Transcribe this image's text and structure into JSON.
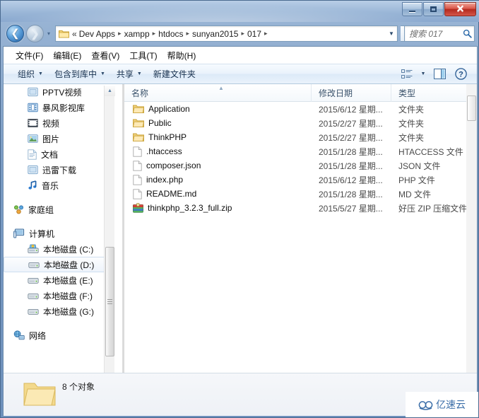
{
  "window": {
    "caption_buttons": [
      {
        "name": "minimize",
        "label": "—"
      },
      {
        "name": "maximize",
        "label": "□"
      },
      {
        "name": "close",
        "label": "✕"
      }
    ]
  },
  "address_bar": {
    "back_label": "←",
    "forward_label": "→",
    "recent_label": "▼",
    "folder_icon": "folder-icon",
    "overflow": "«",
    "crumbs": [
      {
        "label": "Dev Apps"
      },
      {
        "label": "xampp"
      },
      {
        "label": "htdocs"
      },
      {
        "label": "sunyan2015"
      },
      {
        "label": "017"
      }
    ],
    "separator": "▸",
    "dropdown_label": "▼",
    "refresh_label": "↻"
  },
  "search": {
    "placeholder": "搜索 017",
    "icon": "search-icon"
  },
  "menubar": {
    "items": [
      {
        "label": "文件(F)",
        "name": "menu-file"
      },
      {
        "label": "编辑(E)",
        "name": "menu-edit"
      },
      {
        "label": "查看(V)",
        "name": "menu-view"
      },
      {
        "label": "工具(T)",
        "name": "menu-tools"
      },
      {
        "label": "帮助(H)",
        "name": "menu-help"
      }
    ]
  },
  "toolbar": {
    "items": [
      {
        "label": "组织",
        "caret": "▼",
        "name": "toolbar-organize"
      },
      {
        "label": "包含到库中",
        "caret": "▼",
        "name": "toolbar-include-in-library"
      },
      {
        "label": "共享",
        "caret": "▼",
        "name": "toolbar-share"
      },
      {
        "label": "新建文件夹",
        "caret": "",
        "name": "toolbar-new-folder"
      }
    ],
    "view_caret": "▼",
    "icons": {
      "views": "views-list-icon",
      "preview_pane": "preview-pane-icon",
      "help": "help-icon",
      "help_glyph": "?"
    }
  },
  "nav_pane": {
    "items": [
      {
        "label": "PPTV视频",
        "icon": "pptv-video-icon",
        "indent": "indent2",
        "selected": false
      },
      {
        "label": "暴风影视库",
        "icon": "storm-video-library-icon",
        "indent": "indent2",
        "selected": false
      },
      {
        "label": "视频",
        "icon": "videos-icon",
        "indent": "indent2",
        "selected": false
      },
      {
        "label": "图片",
        "icon": "pictures-icon",
        "indent": "indent2",
        "selected": false
      },
      {
        "label": "文档",
        "icon": "documents-icon",
        "indent": "indent2",
        "selected": false
      },
      {
        "label": "迅雷下载",
        "icon": "thunder-downloads-icon",
        "indent": "indent2",
        "selected": false
      },
      {
        "label": "音乐",
        "icon": "music-icon",
        "indent": "indent2",
        "selected": false
      },
      {
        "spacer": true
      },
      {
        "label": "家庭组",
        "icon": "homegroup-icon",
        "indent": "group",
        "selected": false
      },
      {
        "spacer": true
      },
      {
        "label": "计算机",
        "icon": "computer-icon",
        "indent": "group",
        "selected": false
      },
      {
        "label": "本地磁盘 (C:)",
        "icon": "system-drive-icon",
        "indent": "indent2",
        "selected": false
      },
      {
        "label": "本地磁盘 (D:)",
        "icon": "drive-icon",
        "indent": "indent2",
        "selected": true
      },
      {
        "label": "本地磁盘 (E:)",
        "icon": "drive-icon",
        "indent": "indent2",
        "selected": false
      },
      {
        "label": "本地磁盘 (F:)",
        "icon": "drive-icon",
        "indent": "indent2",
        "selected": false
      },
      {
        "label": "本地磁盘 (G:)",
        "icon": "drive-icon",
        "indent": "indent2",
        "selected": false
      },
      {
        "spacer": true
      },
      {
        "label": "网络",
        "icon": "network-icon",
        "indent": "group",
        "selected": false
      }
    ],
    "scroll_up": "▲",
    "scroll_down": "▼"
  },
  "file_list": {
    "columns": [
      {
        "label": "名称",
        "name": "column-name"
      },
      {
        "label": "修改日期",
        "name": "column-date-modified"
      },
      {
        "label": "类型",
        "name": "column-type"
      }
    ],
    "sort_indicator": "▲",
    "rows": [
      {
        "name": "Application",
        "date": "2015/6/12 星期...",
        "type": "文件夹",
        "icon": "folder-icon"
      },
      {
        "name": "Public",
        "date": "2015/2/27 星期...",
        "type": "文件夹",
        "icon": "folder-icon"
      },
      {
        "name": "ThinkPHP",
        "date": "2015/2/27 星期...",
        "type": "文件夹",
        "icon": "folder-icon"
      },
      {
        "name": ".htaccess",
        "date": "2015/1/28 星期...",
        "type": "HTACCESS 文件",
        "icon": "file-icon"
      },
      {
        "name": "composer.json",
        "date": "2015/1/28 星期...",
        "type": "JSON 文件",
        "icon": "file-icon"
      },
      {
        "name": "index.php",
        "date": "2015/6/12 星期...",
        "type": "PHP 文件",
        "icon": "file-icon"
      },
      {
        "name": "README.md",
        "date": "2015/1/28 星期...",
        "type": "MD 文件",
        "icon": "file-icon"
      },
      {
        "name": "thinkphp_3.2.3_full.zip",
        "date": "2015/5/27 星期...",
        "type": "好压 ZIP 压缩文件",
        "icon": "zip-archive-icon"
      }
    ],
    "hscroll_left": "◂",
    "hscroll_right": "▸"
  },
  "status_bar": {
    "text": "8 个对象",
    "icon": "folder-icon"
  },
  "watermark": {
    "text": "亿速云",
    "logo": "cloud-logo-icon"
  },
  "colors": {
    "accent": "#2a68a8",
    "close_button": "#b32a1e",
    "folder_yellow": "#ffd97a",
    "title_glass": "#9ab6d7"
  }
}
